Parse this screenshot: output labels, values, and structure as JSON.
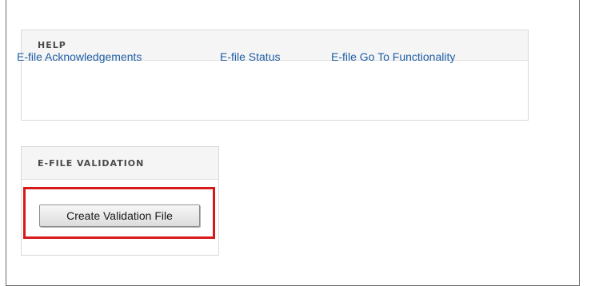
{
  "help": {
    "title": "HELP",
    "links": [
      "E-file Acknowledgements",
      "E-file Status",
      "E-file Go To Functionality"
    ]
  },
  "efile_validation": {
    "title": "E-FILE VALIDATION",
    "button_label": "Create Validation File"
  },
  "colors": {
    "link": "#1f5fa6",
    "highlight": "#d7191c",
    "header_bg": "#f5f5f5"
  }
}
